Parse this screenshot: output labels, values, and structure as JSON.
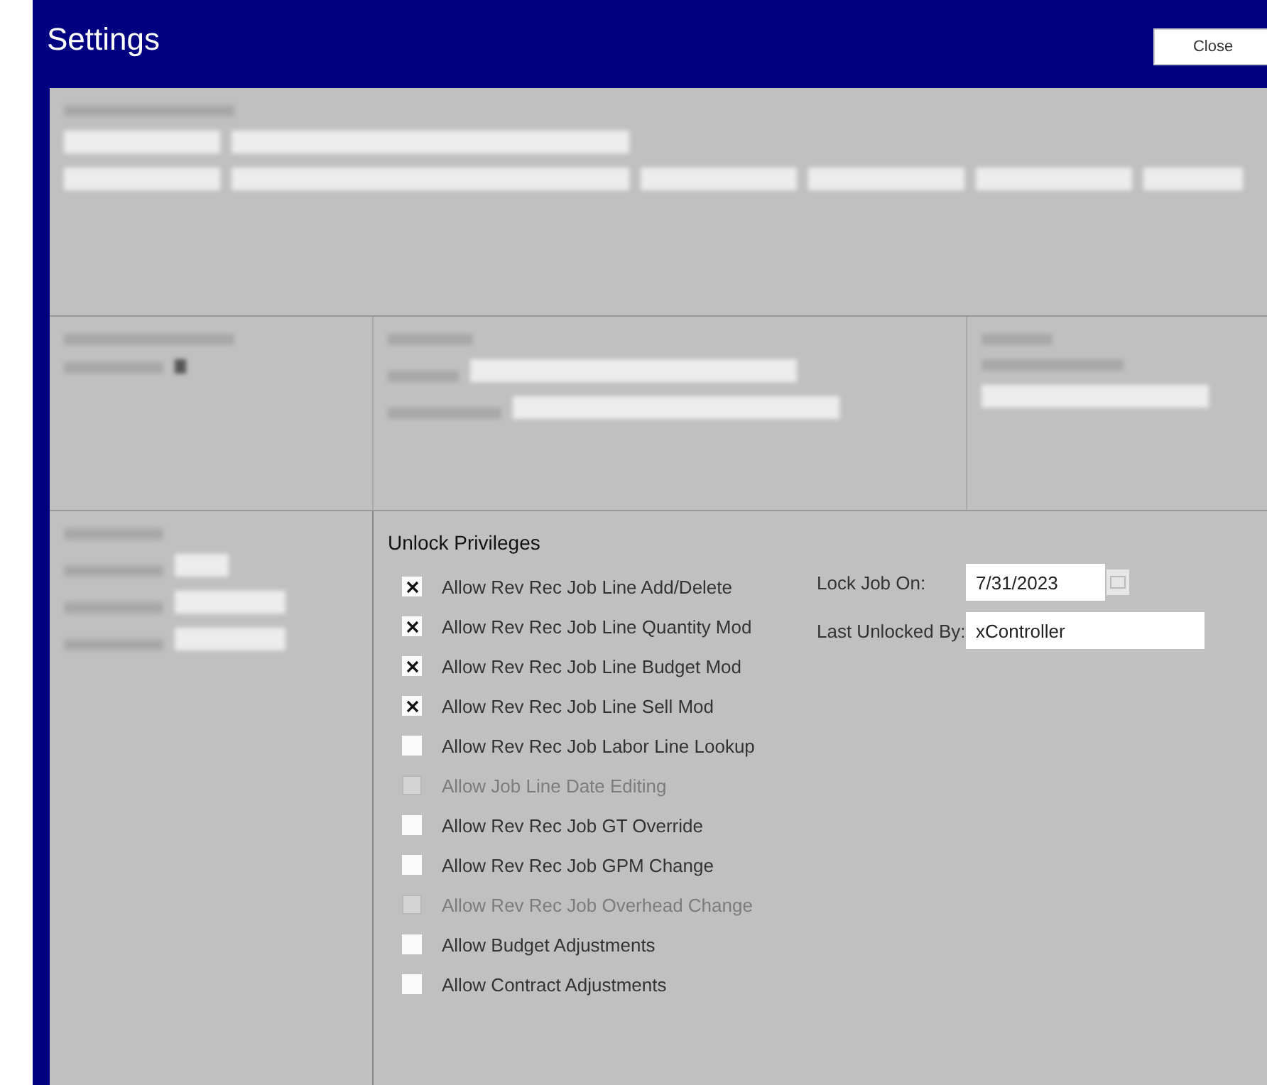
{
  "window": {
    "title": "Settings"
  },
  "close_button": {
    "label": "Close"
  },
  "unlock_privileges": {
    "title": "Unlock Privileges",
    "items": [
      {
        "label": "Allow Rev Rec Job Line Add/Delete",
        "checked": true,
        "disabled": false
      },
      {
        "label": "Allow Rev Rec Job Line Quantity Mod",
        "checked": true,
        "disabled": false
      },
      {
        "label": "Allow Rev Rec Job Line Budget Mod",
        "checked": true,
        "disabled": false
      },
      {
        "label": "Allow Rev Rec Job Line Sell Mod",
        "checked": true,
        "disabled": false
      },
      {
        "label": "Allow Rev Rec Job Labor Line Lookup",
        "checked": false,
        "disabled": false
      },
      {
        "label": "Allow Job Line Date Editing",
        "checked": false,
        "disabled": true
      },
      {
        "label": "Allow Rev Rec Job GT Override",
        "checked": false,
        "disabled": false
      },
      {
        "label": "Allow Rev Rec Job GPM Change",
        "checked": false,
        "disabled": false
      },
      {
        "label": "Allow Rev Rec Job Overhead Change",
        "checked": false,
        "disabled": true
      },
      {
        "label": "Allow Budget Adjustments",
        "checked": false,
        "disabled": false
      },
      {
        "label": "Allow Contract Adjustments",
        "checked": false,
        "disabled": false
      }
    ],
    "lock_job_on": {
      "label": "Lock Job On:",
      "value": "7/31/2023"
    },
    "last_unlocked_by": {
      "label": "Last Unlocked By:",
      "value": "xController"
    }
  }
}
